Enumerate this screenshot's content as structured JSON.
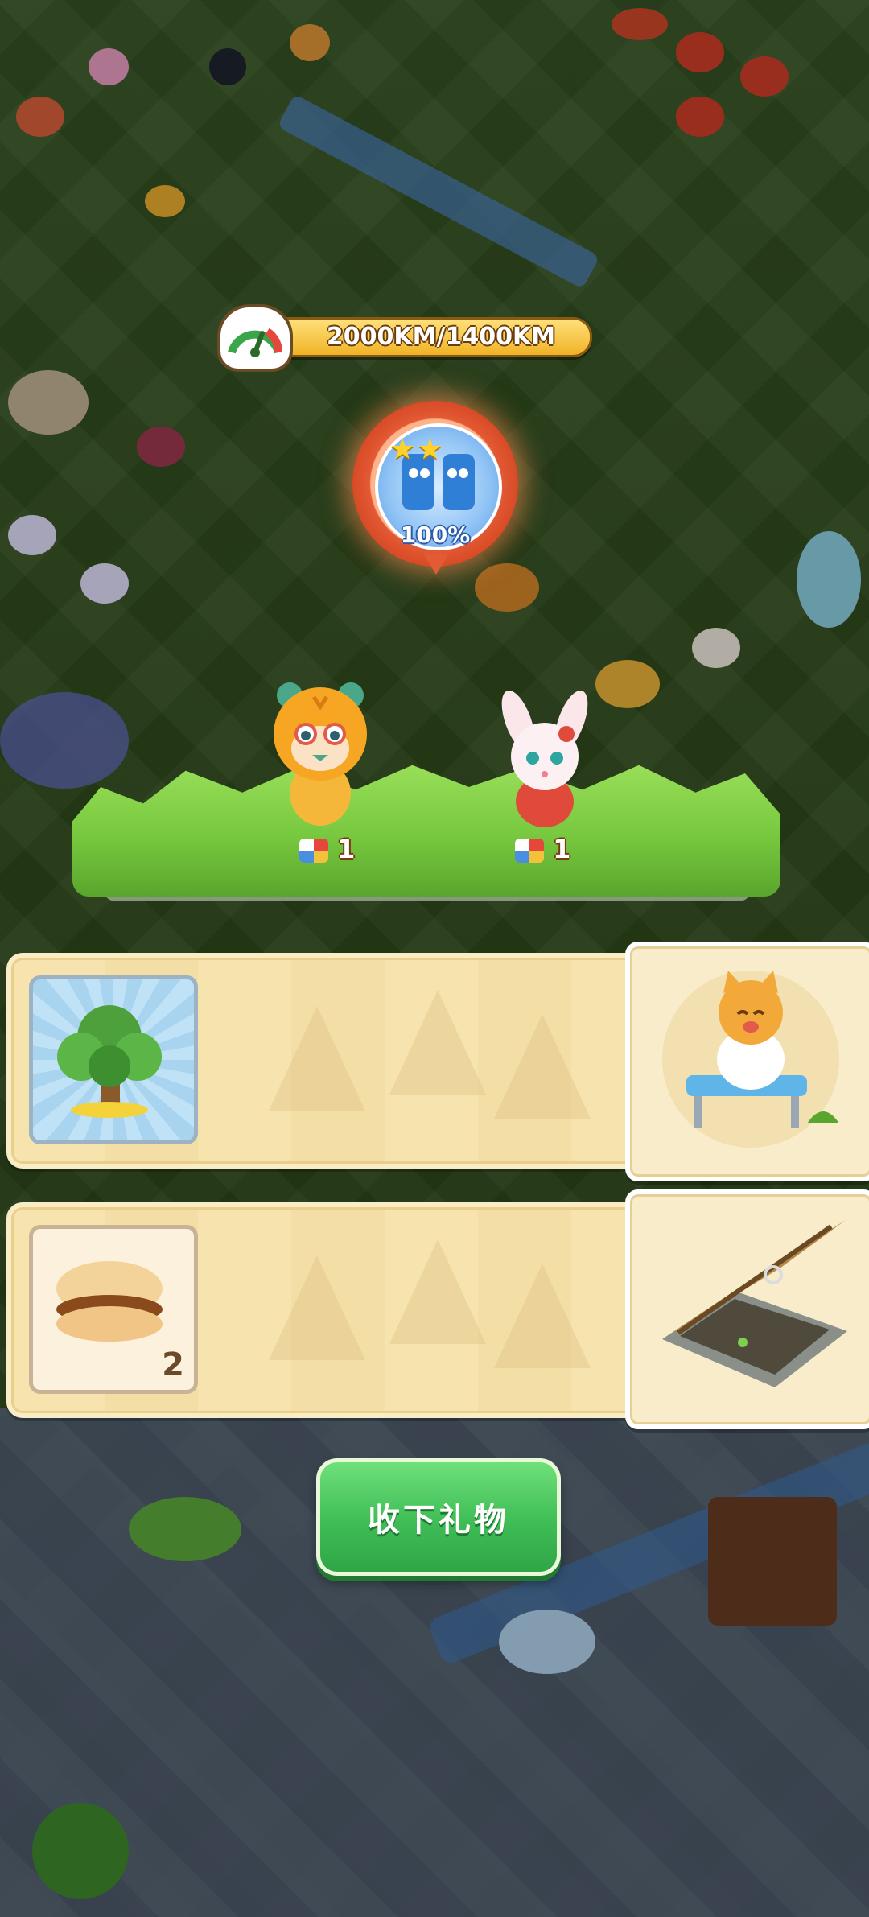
{
  "distance": {
    "label": "2000KM/1400KM",
    "current_km": 2000,
    "target_km": 1400
  },
  "badge": {
    "stars": "★★",
    "percent": "100%"
  },
  "characters": [
    {
      "name": "tiger",
      "gift_count": "1"
    },
    {
      "name": "bunny",
      "gift_count": "1"
    }
  ],
  "rewards": [
    {
      "item": "tree",
      "quantity": ""
    },
    {
      "item": "burger",
      "quantity": "2"
    }
  ],
  "collect_button": {
    "label": "收下礼物"
  },
  "colors": {
    "button_green": "#3fbd55",
    "panel_cream": "#f6e3ad",
    "badge_red": "#e35a34",
    "bar_gold": "#e8ae22"
  }
}
